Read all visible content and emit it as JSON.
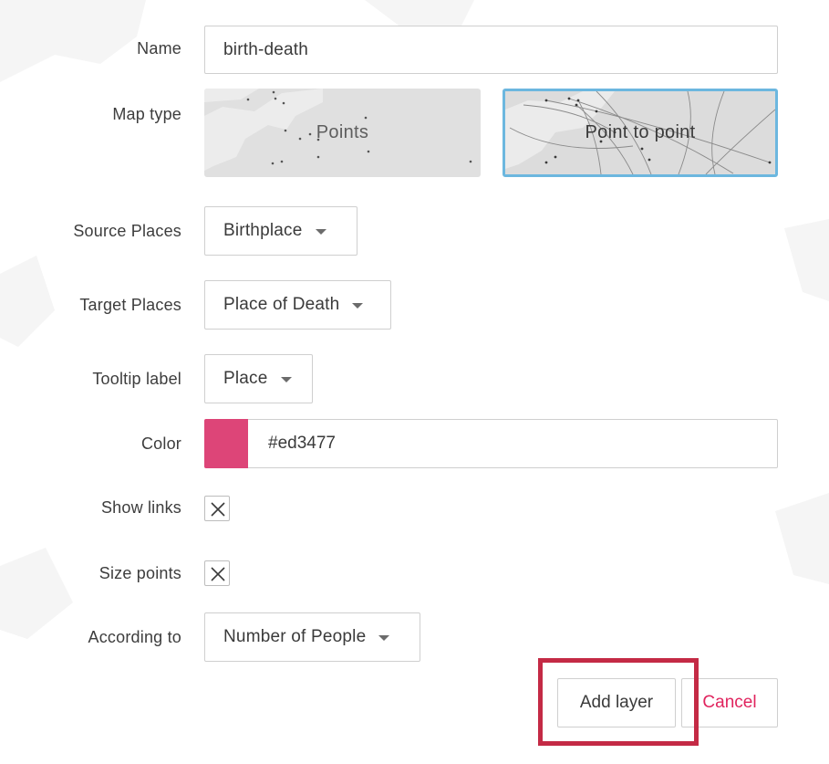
{
  "form": {
    "name": {
      "label": "Name",
      "value": "birth-death"
    },
    "map_type": {
      "label": "Map type",
      "options": [
        {
          "label": "Points",
          "selected": false
        },
        {
          "label": "Point to point",
          "selected": true
        }
      ]
    },
    "source_places": {
      "label": "Source Places",
      "value": "Birthplace"
    },
    "target_places": {
      "label": "Target Places",
      "value": "Place of Death"
    },
    "tooltip_label": {
      "label": "Tooltip label",
      "value": "Place"
    },
    "color": {
      "label": "Color",
      "value": "#ed3477",
      "swatch": "#dd4578"
    },
    "show_links": {
      "label": "Show links",
      "checked": true
    },
    "size_points": {
      "label": "Size points",
      "checked": true
    },
    "according_to": {
      "label": "According to",
      "value": "Number of People"
    }
  },
  "actions": {
    "add_label": "Add layer",
    "cancel_label": "Cancel"
  },
  "colors": {
    "selected_border": "#6cb7df",
    "cancel_text": "#e0245e",
    "highlight_box": "#c42a45"
  },
  "icons": {
    "dropdown": "caret-down-icon",
    "checkbox_mark": "x-mark-icon"
  }
}
